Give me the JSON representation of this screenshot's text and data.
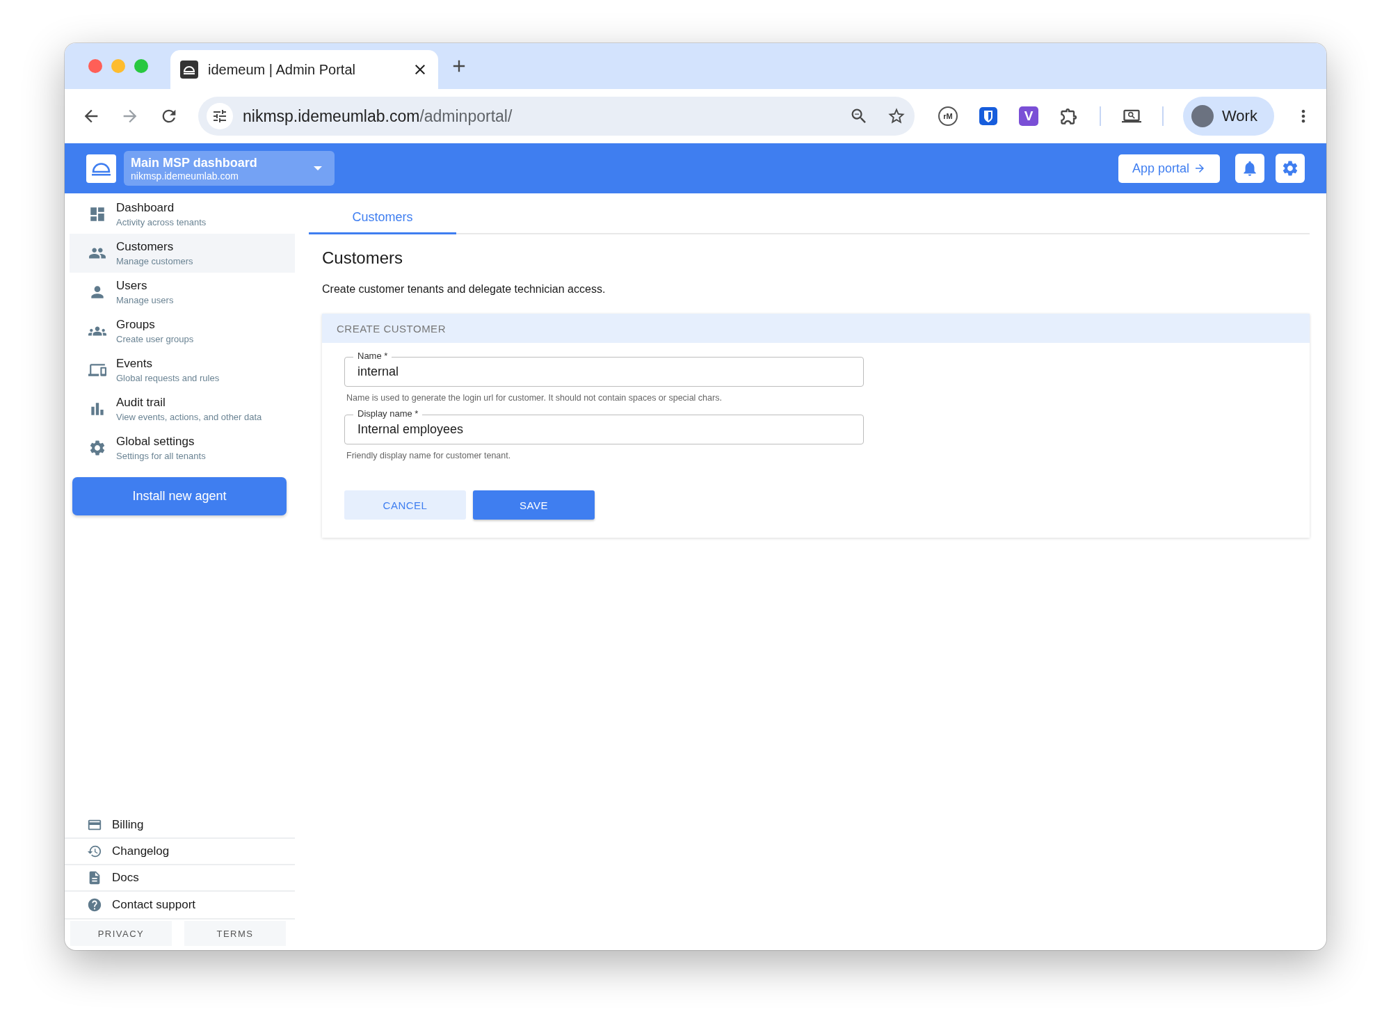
{
  "browser": {
    "tab": {
      "title": "idemeum | Admin Portal"
    },
    "url": {
      "host": "nikmsp.idemeumlab.com",
      "path": "/adminportal/"
    },
    "extensions": [
      {
        "kind": "letter-circle",
        "text": "rM"
      },
      {
        "kind": "shield"
      },
      {
        "kind": "letter-square",
        "text": "V"
      },
      {
        "kind": "puzzle"
      }
    ],
    "profile": {
      "label": "Work"
    }
  },
  "header": {
    "workspace": {
      "title": "Main MSP dashboard",
      "subtitle": "nikmsp.idemeumlab.com"
    },
    "app_portal_button": "App portal"
  },
  "sidebar": {
    "items": [
      {
        "title": "Dashboard",
        "subtitle": "Activity across tenants",
        "selected": false
      },
      {
        "title": "Customers",
        "subtitle": "Manage customers",
        "selected": true
      },
      {
        "title": "Users",
        "subtitle": "Manage users",
        "selected": false
      },
      {
        "title": "Groups",
        "subtitle": "Create user groups",
        "selected": false
      },
      {
        "title": "Events",
        "subtitle": "Global requests and rules",
        "selected": false
      },
      {
        "title": "Audit trail",
        "subtitle": "View events, actions, and other data",
        "selected": false
      },
      {
        "title": "Global settings",
        "subtitle": "Settings for all tenants",
        "selected": false
      }
    ],
    "install_button": "Install new agent",
    "footer_links": [
      "Billing",
      "Changelog",
      "Docs",
      "Contact support"
    ],
    "legal_buttons": [
      "PRIVACY",
      "TERMS"
    ]
  },
  "main": {
    "tabs": [
      {
        "label": "Customers",
        "selected": true
      }
    ],
    "heading": "Customers",
    "description": "Create customer tenants and delegate technician access.",
    "card": {
      "title": "CREATE CUSTOMER",
      "fields": [
        {
          "label": "Name *",
          "value": "internal",
          "helper": "Name is used to generate the login url for customer. It should not contain spaces or special chars."
        },
        {
          "label": "Display name *",
          "value": "Internal employees",
          "helper": "Friendly display name for customer tenant."
        }
      ],
      "buttons": [
        {
          "label": "CANCEL",
          "kind": "secondary"
        },
        {
          "label": "SAVE",
          "kind": "primary"
        }
      ]
    }
  }
}
